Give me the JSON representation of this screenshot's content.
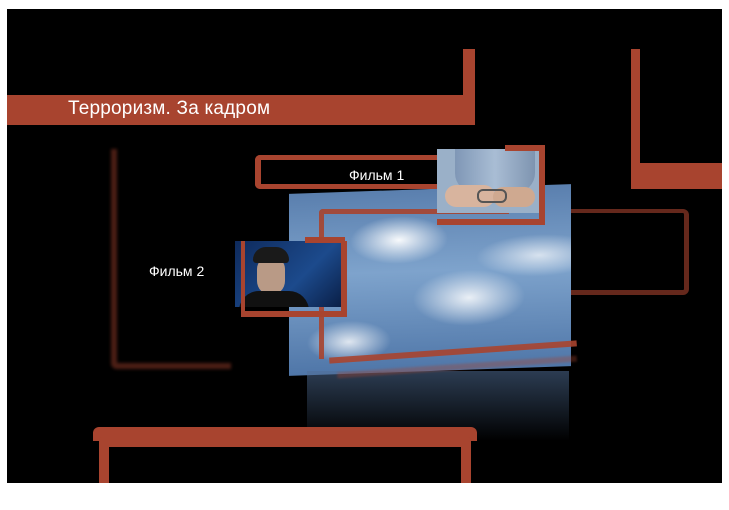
{
  "menu": {
    "title": "Терроризм. За кадром",
    "items": [
      {
        "label": "Фильм 1",
        "thumbnail": "handcuffed-hands"
      },
      {
        "label": "Фильм 2",
        "thumbnail": "man-in-cap-portrait"
      }
    ]
  },
  "colors": {
    "accent": "#a8442f",
    "background": "#000000",
    "text": "#ffffff"
  }
}
